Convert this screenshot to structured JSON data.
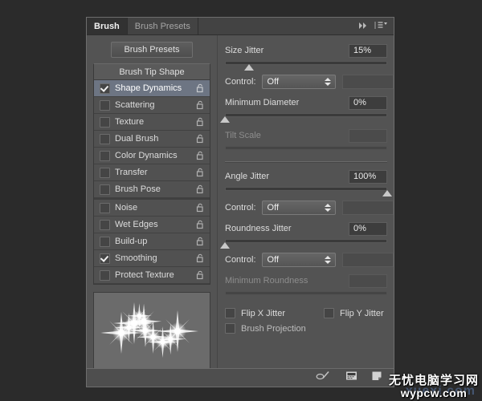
{
  "window": {
    "background": "#2b2b2b"
  },
  "panel": {
    "tabs": [
      {
        "label": "Brush",
        "active": true
      },
      {
        "label": "Brush Presets",
        "active": false
      }
    ],
    "header_icons": [
      {
        "name": "collapse-double-chevron-icon"
      },
      {
        "name": "panel-menu-icon"
      }
    ],
    "presets_button": "Brush Presets",
    "accent_selected": "#6d7583",
    "background": "#535353"
  },
  "options": {
    "header": "Brush Tip Shape",
    "items": [
      {
        "label": "Shape Dynamics",
        "checked": true,
        "selected": true,
        "locked": false
      },
      {
        "label": "Scattering",
        "checked": false,
        "selected": false,
        "locked": false
      },
      {
        "label": "Texture",
        "checked": false,
        "selected": false,
        "locked": false
      },
      {
        "label": "Dual Brush",
        "checked": false,
        "selected": false,
        "locked": false
      },
      {
        "label": "Color Dynamics",
        "checked": false,
        "selected": false,
        "locked": false
      },
      {
        "label": "Transfer",
        "checked": false,
        "selected": false,
        "locked": false
      },
      {
        "label": "Brush Pose",
        "checked": false,
        "selected": false,
        "locked": false
      },
      {
        "label": "Noise",
        "checked": false,
        "selected": false,
        "locked": false
      },
      {
        "label": "Wet Edges",
        "checked": false,
        "selected": false,
        "locked": false
      },
      {
        "label": "Build-up",
        "checked": false,
        "selected": false,
        "locked": false
      },
      {
        "label": "Smoothing",
        "checked": true,
        "selected": false,
        "locked": false
      },
      {
        "label": "Protect Texture",
        "checked": false,
        "selected": false,
        "locked": false
      }
    ]
  },
  "preview": {
    "name": "brush-stroke-preview",
    "description": "sparkle star brush stroke"
  },
  "controls": {
    "size_jitter": {
      "label": "Size Jitter",
      "value": "15%",
      "percent": 15,
      "enabled": true
    },
    "size_control": {
      "label": "Control:",
      "value": "Off",
      "enabled": true
    },
    "minimum_diameter": {
      "label": "Minimum Diameter",
      "value": "0%",
      "percent": 0,
      "enabled": true
    },
    "tilt_scale": {
      "label": "Tilt Scale",
      "value": "",
      "percent": 0,
      "enabled": false
    },
    "angle_jitter": {
      "label": "Angle Jitter",
      "value": "100%",
      "percent": 100,
      "enabled": true
    },
    "angle_control": {
      "label": "Control:",
      "value": "Off",
      "enabled": true
    },
    "roundness_jitter": {
      "label": "Roundness Jitter",
      "value": "0%",
      "percent": 0,
      "enabled": true
    },
    "roundness_control": {
      "label": "Control:",
      "value": "Off",
      "enabled": true
    },
    "minimum_roundness": {
      "label": "Minimum Roundness",
      "value": "",
      "percent": 0,
      "enabled": false
    },
    "flip_x_jitter": {
      "label": "Flip X Jitter",
      "checked": false,
      "enabled": true
    },
    "flip_y_jitter": {
      "label": "Flip Y Jitter",
      "checked": false,
      "enabled": true
    },
    "brush_projection": {
      "label": "Brush Projection",
      "checked": false,
      "enabled": false
    }
  },
  "footer_icons": [
    {
      "name": "toggle-brush-settings-icon"
    },
    {
      "name": "brush-presets-grid-icon"
    },
    {
      "name": "new-brush-icon"
    }
  ],
  "watermark": {
    "chinese": "无忧电脑学习网",
    "english": "wypcw.com",
    "ghost": "xuexi.com"
  }
}
